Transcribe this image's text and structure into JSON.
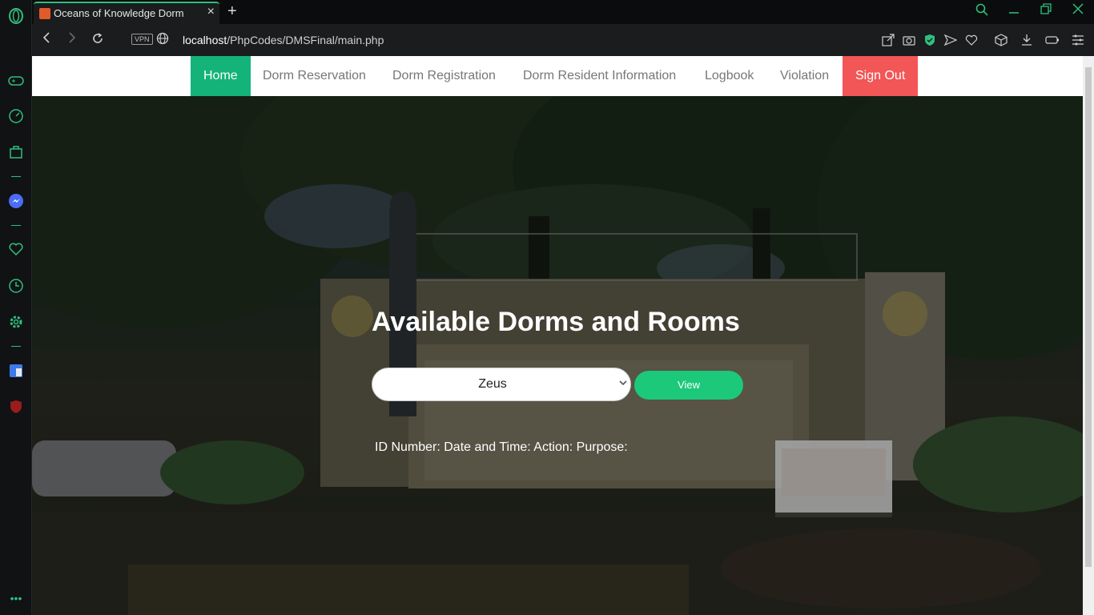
{
  "browser": {
    "tab_title": "Oceans of Knowledge Dorm",
    "new_tab_symbol": "+",
    "address_url_host": "localhost",
    "address_url_path": "/PhpCodes/DMSFinal/main.php",
    "vpn_label": "VPN",
    "accent": "#2fbf7e"
  },
  "sidebar": {
    "icons": [
      "opera-logo-icon",
      "gamepad-icon",
      "speed-dial-icon",
      "bag-icon",
      "messenger-icon",
      "heart-icon",
      "history-icon",
      "settings-icon",
      "translate-icon",
      "ublock-icon",
      "more-icon"
    ]
  },
  "nav": {
    "items": [
      {
        "label": "Home",
        "active": true
      },
      {
        "label": "Dorm Reservation"
      },
      {
        "label": "Dorm Registration"
      },
      {
        "label": "Dorm Resident Information"
      },
      {
        "label": "Logbook"
      },
      {
        "label": "Violation"
      },
      {
        "label": "Sign Out"
      }
    ],
    "colors": {
      "home": "#14b37a",
      "signout": "#f25656"
    }
  },
  "hero": {
    "title": "Available Dorms and Rooms",
    "selected_dorm": "Zeus",
    "view_button": "View",
    "log_line": "ID Number: Date and Time: Action: Purpose:"
  }
}
